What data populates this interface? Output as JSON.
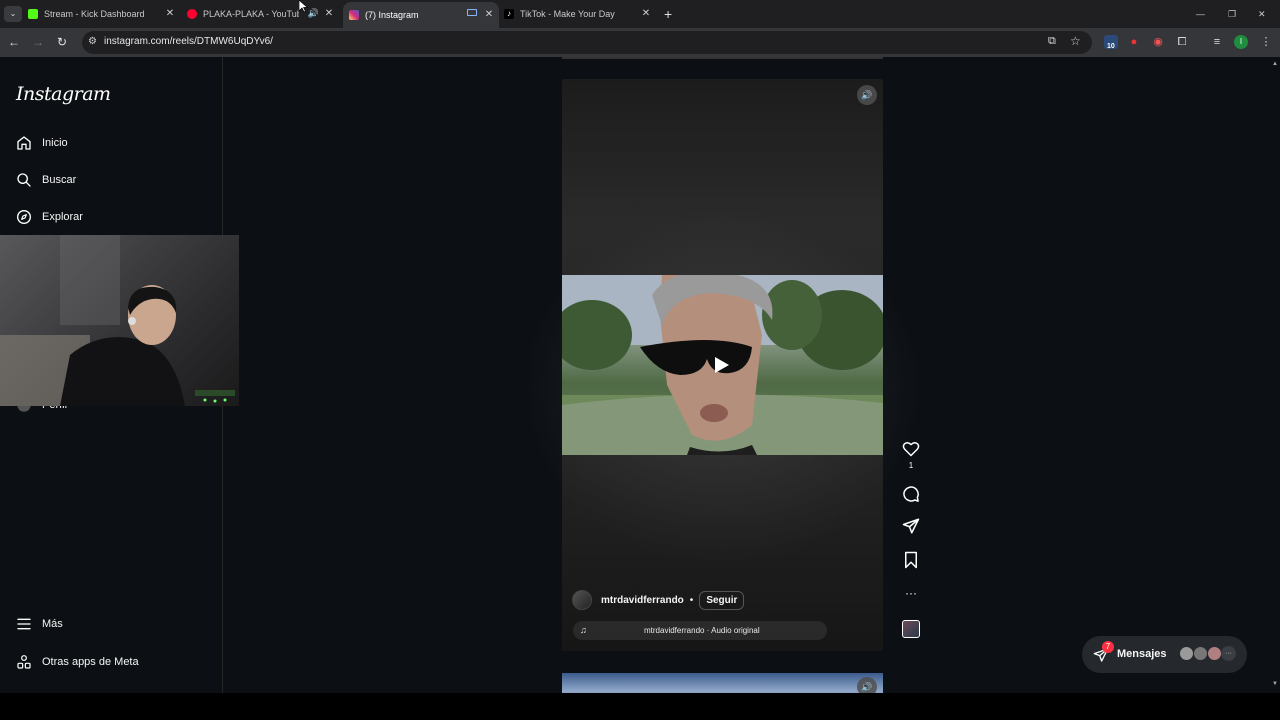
{
  "browser": {
    "tabs": [
      {
        "title": "Stream - Kick Dashboard",
        "favicon_color": "#53fc18"
      },
      {
        "title": "PLAKA-PLAKA - YouTube Music",
        "favicon_color": "#ff0033"
      },
      {
        "title": "(7) Instagram",
        "favicon_color": "#d6249f"
      },
      {
        "title": "TikTok - Make Your Day",
        "favicon_color": "#ffffff"
      }
    ],
    "new_tab_label": "+",
    "url": "instagram.com/reels/DTMW6UqDYv6/",
    "extension_badge": "10",
    "profile_initial": "I",
    "window": {
      "minimize": "—",
      "restore": "❐",
      "close": "✕"
    }
  },
  "sidebar": {
    "logo": "Instagram",
    "items": [
      {
        "label": "Inicio",
        "icon": "home-icon"
      },
      {
        "label": "Buscar",
        "icon": "search-icon"
      },
      {
        "label": "Explorar",
        "icon": "compass-icon"
      },
      {
        "label": "Perfil",
        "icon": "profile-icon"
      }
    ],
    "more": "Más",
    "meta_apps": "Otras apps de Meta"
  },
  "reel": {
    "likes": "1",
    "author": "mtrdavidferrando",
    "separator": "•",
    "follow": "Seguir",
    "audio": "mtrdavidferrando · Audio original"
  },
  "messages": {
    "label": "Mensajes",
    "badge": "7"
  },
  "colors": {
    "page_bg": "#0c1014",
    "tab_bg": "#1f1f22",
    "toolbar_bg": "#35363a",
    "badge_red": "#ff3040"
  }
}
